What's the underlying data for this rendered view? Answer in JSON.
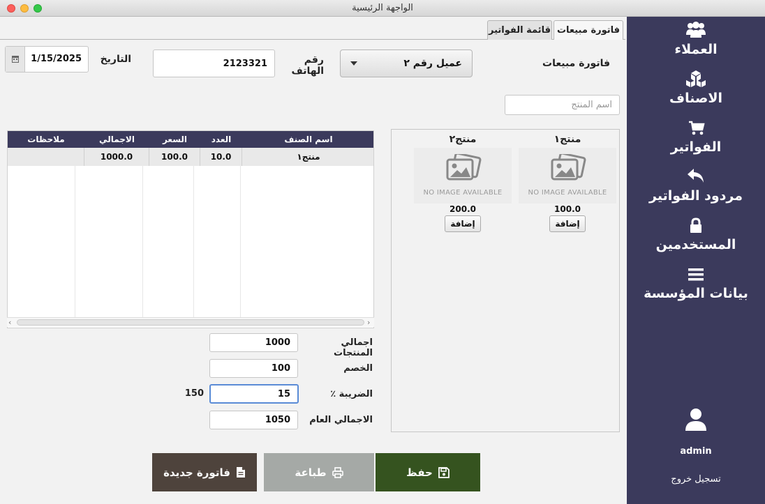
{
  "window": {
    "title": "الواجهة الرئيسية"
  },
  "sidebar": {
    "items": [
      {
        "label": "العملاء",
        "icon": "users-icon"
      },
      {
        "label": "الاصناف",
        "icon": "cubes-icon"
      },
      {
        "label": "الفواتير",
        "icon": "cart-icon"
      },
      {
        "label": "مردود الفواتير",
        "icon": "reply-icon"
      },
      {
        "label": "المستخدمين",
        "icon": "lock-icon"
      },
      {
        "label": "بيانات المؤسسة",
        "icon": "menu-icon"
      }
    ],
    "user": {
      "name": "admin",
      "icon": "user-icon"
    },
    "logout_label": "تسجيل خروج"
  },
  "tabs": [
    {
      "label": "فاتورة مبيعات",
      "active": true
    },
    {
      "label": "قائمة الفواتير",
      "active": false
    }
  ],
  "invoice": {
    "type_label": "فاتورة مبيعات",
    "customer_selected": "عميل رقم ٢",
    "phone_label": "رقم الهاتف",
    "phone_value": "2123321",
    "date_label": "التاريخ",
    "date_value": "1/15/2025",
    "product_search_placeholder": "اسم المنتج"
  },
  "table": {
    "columns": [
      "اسم الصنف",
      "العدد",
      "السعر",
      "الاجمالي",
      "ملاحظات"
    ],
    "rows": [
      {
        "name": "منتج١",
        "qty": "10.0",
        "price": "100.0",
        "total": "1000.0",
        "notes": ""
      }
    ]
  },
  "products": [
    {
      "name": "منتج١",
      "image_text": "NO IMAGE AVAILABLE",
      "price": "100.0",
      "add_label": "إضافة"
    },
    {
      "name": "منتج٢",
      "image_text": "NO IMAGE AVAILABLE",
      "price": "200.0",
      "add_label": "إضافة"
    }
  ],
  "summary": {
    "products_total_label": "اجمالي المنتجات",
    "products_total": "1000",
    "discount_label": "الخصم",
    "discount": "100",
    "tax_label": "الضريبة ٪",
    "tax": "15",
    "tax_amount": "150",
    "grand_total_label": "الاجمالي العام",
    "grand_total": "1050"
  },
  "buttons": {
    "save": "حفظ",
    "print": "طباعة",
    "new_invoice": "فاتورة جديدة"
  },
  "colors": {
    "sidebar": "#3b3a5c",
    "save": "#35531f",
    "print": "#a5a9a6",
    "new_invoice": "#4e433c"
  }
}
